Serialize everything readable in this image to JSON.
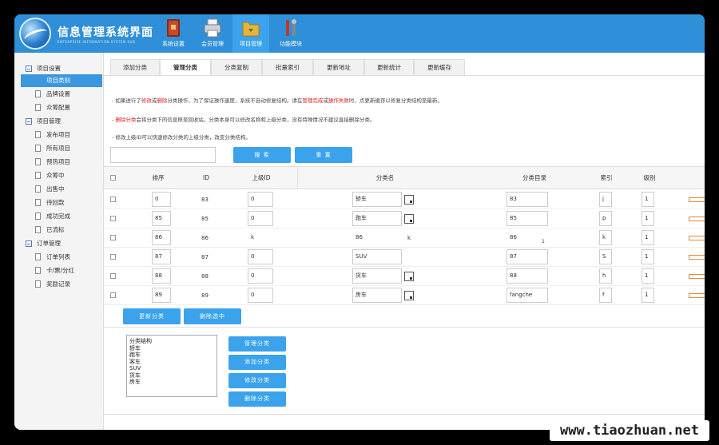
{
  "app": {
    "title": "信息管理系统界面",
    "subtitle": "ENTERPRISE INFORMATION SYSTEM SUB"
  },
  "nav": [
    {
      "label": "系统设置",
      "icon": "book-icon"
    },
    {
      "label": "会员管理",
      "icon": "printer-icon"
    },
    {
      "label": "项目管理",
      "icon": "folder-icon",
      "active": true
    },
    {
      "label": "功能模块",
      "icon": "tools-icon"
    }
  ],
  "sidebar": {
    "groups": [
      {
        "label": "项目设置",
        "items": [
          "项目类别",
          "品牌设置",
          "众筹配置"
        ]
      },
      {
        "label": "项目管理",
        "items": [
          "发布项目",
          "所有项目",
          "预热项目",
          "众筹中",
          "出售中",
          "待回款",
          "成功完成",
          "已流标"
        ]
      },
      {
        "label": "订单管理",
        "items": [
          "订单列表",
          "卡/票/分红",
          "奖励记录"
        ]
      }
    ],
    "active": "项目类别"
  },
  "tabs": [
    "添加分类",
    "管理分类",
    "分类复制",
    "批量索引",
    "更新地址",
    "更新统计",
    "更新缓存"
  ],
  "active_tab": "管理分类",
  "tips": {
    "t1_a": "- 如果进行了",
    "t1_b": "修改",
    "t1_c": "或",
    "t1_d": "删除",
    "t1_e": "分类操作，为了保证操作速度，系统不自动修复结构。请在",
    "t1_f": "管理完成",
    "t1_g": "或",
    "t1_h": "操作失败",
    "t1_i": "时，点更新缓存以修复分类结构至最新。",
    "t2_a": "- ",
    "t2_b": "删除分类",
    "t2_c": "会将分类下的信息移至回收站，分类本身可以修改名称和上级分类，没有特殊情况不建议直接删除分类。",
    "t3": "- 修改上级ID可以快速修改分类的上级分类，改变分类结构。"
  },
  "search": {
    "placeholder": "",
    "search_label": "搜 索",
    "reset_label": "重 置"
  },
  "table": {
    "headers": {
      "sort": "排序",
      "id": "ID",
      "parent": "上级ID",
      "name": "分类名",
      "dir": "分类目录",
      "index": "索引",
      "level": "级别"
    },
    "rows": [
      {
        "sort": "0",
        "id": "83",
        "parent": "0",
        "name": "轿车",
        "dir": "83",
        "index": "j",
        "level": "1"
      },
      {
        "sort": "85",
        "id": "85",
        "parent": "0",
        "name": "跑车",
        "dir": "85",
        "index": "p",
        "level": "1"
      },
      {
        "sort": "86",
        "id": "86",
        "parent": "k",
        "name": "86",
        "name_extra": "k",
        "dir": "86",
        "dir_extra": "1",
        "index": "k",
        "level": "1"
      },
      {
        "sort": "87",
        "id": "87",
        "parent": "0",
        "name": "SUV",
        "dir": "87",
        "index": "S",
        "level": "1"
      },
      {
        "sort": "88",
        "id": "88",
        "parent": "0",
        "name": "货车",
        "dir": "88",
        "index": "h",
        "level": "1"
      },
      {
        "sort": "89",
        "id": "89",
        "parent": "0",
        "name": "房车",
        "dir": "fangche",
        "index": "f",
        "level": "1"
      }
    ]
  },
  "actions": {
    "update": "更新分类",
    "delete_selected": "删除选中"
  },
  "tree": {
    "items": [
      "分类结构",
      "轿车",
      "跑车",
      "客车",
      "SUV",
      "货车",
      "房车"
    ]
  },
  "side_actions": {
    "manage": "管理分类",
    "add": "添加分类",
    "edit": "修改分类",
    "delete": "删除分类"
  },
  "watermark": "www.tiaozhuan.net",
  "colors": {
    "header": "#2f8fd8",
    "accent": "#3aa3ec",
    "warn": "#e02020"
  }
}
